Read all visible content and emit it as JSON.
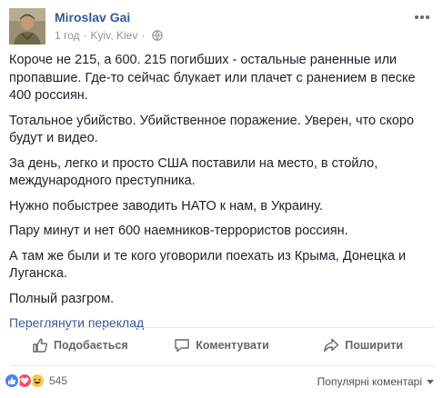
{
  "post": {
    "author": "Miroslav Gai",
    "time": "1 год",
    "separator": "·",
    "location": "Kyiv, Kiev",
    "paragraphs": [
      "Короче не 215, а 600. 215 погибших - остальные раненные или пропавшие. Где-то сейчас блукает или плачет с ранением в песке 400 россиян.",
      "Тотальное убийство. Убийственное поражение. Уверен, что скоро будут и видео.",
      "За день, легко и просто США поставили на место, в стойло, международного преступника.",
      "Нужно побыстрее заводить НАТО к нам, в Украину.",
      "Пару минут и нет 600 наемников-террористов россиян.",
      "А там же были и те кого уговорили поехать из Крыма, Донецка и Луганска.",
      "Полный разгром."
    ],
    "translate_link": "Переглянути переклад"
  },
  "actions": {
    "like": "Подобається",
    "comment": "Коментувати",
    "share": "Поширити"
  },
  "reactions": {
    "count": "545",
    "types": [
      "like",
      "love",
      "haha"
    ]
  },
  "comments_sort": "Популярні коментарі",
  "icons": {
    "more": "more-options-icon",
    "globe": "globe-icon",
    "like": "thumbs-up-icon",
    "comment": "comment-bubble-icon",
    "share": "share-arrow-icon"
  },
  "colors": {
    "link": "#365899",
    "meta": "#90949c",
    "text": "#1d2129",
    "action": "#606770"
  }
}
